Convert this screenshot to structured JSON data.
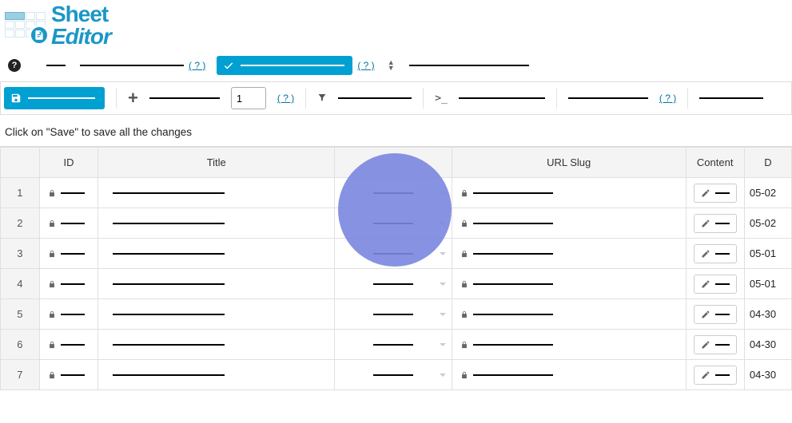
{
  "logo": {
    "line1": "Sheet",
    "line2": "Editor"
  },
  "help_label": "( ? )",
  "toolbar": {
    "page_value": "1"
  },
  "hint": "Click on \"Save\" to save all the changes",
  "columns": {
    "id": "ID",
    "title": "Title",
    "slug": "URL Slug",
    "content": "Content",
    "date": "D"
  },
  "rows": [
    {
      "n": "1",
      "date": "05-02"
    },
    {
      "n": "2",
      "date": "05-02"
    },
    {
      "n": "3",
      "date": "05-01"
    },
    {
      "n": "4",
      "date": "05-01"
    },
    {
      "n": "5",
      "date": "04-30"
    },
    {
      "n": "6",
      "date": "04-30"
    },
    {
      "n": "7",
      "date": "04-30"
    }
  ]
}
